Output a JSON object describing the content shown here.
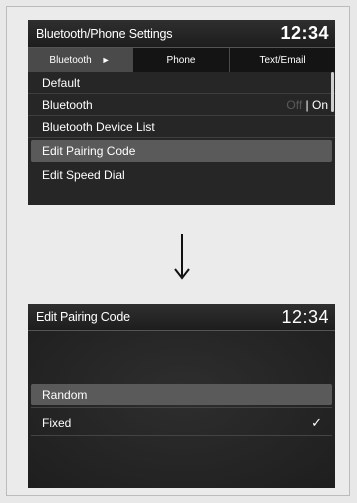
{
  "settings_screen": {
    "title": "Bluetooth/Phone Settings",
    "time": "12:34",
    "tabs": [
      {
        "label": "Bluetooth",
        "arrow": "►"
      },
      {
        "label": "Phone"
      },
      {
        "label": "Text/Email"
      }
    ],
    "items": [
      {
        "label": "Default"
      },
      {
        "label": "Bluetooth",
        "toggle_off": "Off",
        "toggle_sep": " | ",
        "toggle_on": "On"
      },
      {
        "label": "Bluetooth Device List"
      },
      {
        "label": "Edit Pairing Code",
        "selected": true
      },
      {
        "label": "Edit Speed Dial"
      }
    ]
  },
  "transition": {
    "icon": "down-arrow-icon"
  },
  "pairing_screen": {
    "title": "Edit Pairing Code",
    "time": "12:34",
    "options": [
      {
        "label": "Random",
        "selected": true
      },
      {
        "label": "Fixed",
        "checked": true,
        "check_mark": "✓"
      }
    ]
  }
}
